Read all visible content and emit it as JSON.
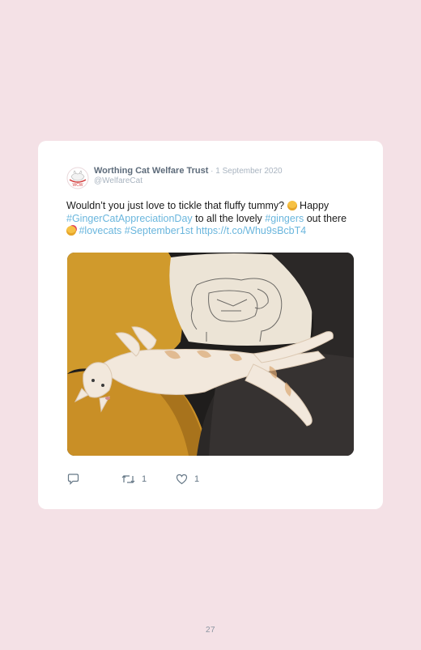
{
  "tweet": {
    "display_name": "Worthing Cat Welfare Trust",
    "separator": " · ",
    "date": "1 September 2020",
    "handle": "@WelfareCat",
    "text": {
      "part1": "Wouldn’t you just love to tickle that fluffy tummy? ",
      "part2": " Happy ",
      "hashtag1": "#GingerCatAppreciationDay",
      "part3": " to all the lovely ",
      "hashtag2": "#gingers",
      "part4": " out there ",
      "hashtag3": "#lovecats",
      "space": " ",
      "hashtag4": "#September1st",
      "url": "https://t.co/Whu9sBcbT4"
    },
    "emoji": [
      "smiling-face-emoji",
      "smiling-face-with-hearts-emoji"
    ],
    "image_alt": "ginger-cat-lying-on-back-photo",
    "reply_icon": "reply-icon",
    "retweet_icon": "retweet-icon",
    "like_icon": "heart-icon",
    "retweet_count": "1",
    "like_count": "1",
    "colors": {
      "link": "#6ab6dd",
      "name": "#5d6b7a",
      "meta": "#a9b4c0",
      "background": "#f4e1e6"
    }
  },
  "page": {
    "number": "27"
  }
}
